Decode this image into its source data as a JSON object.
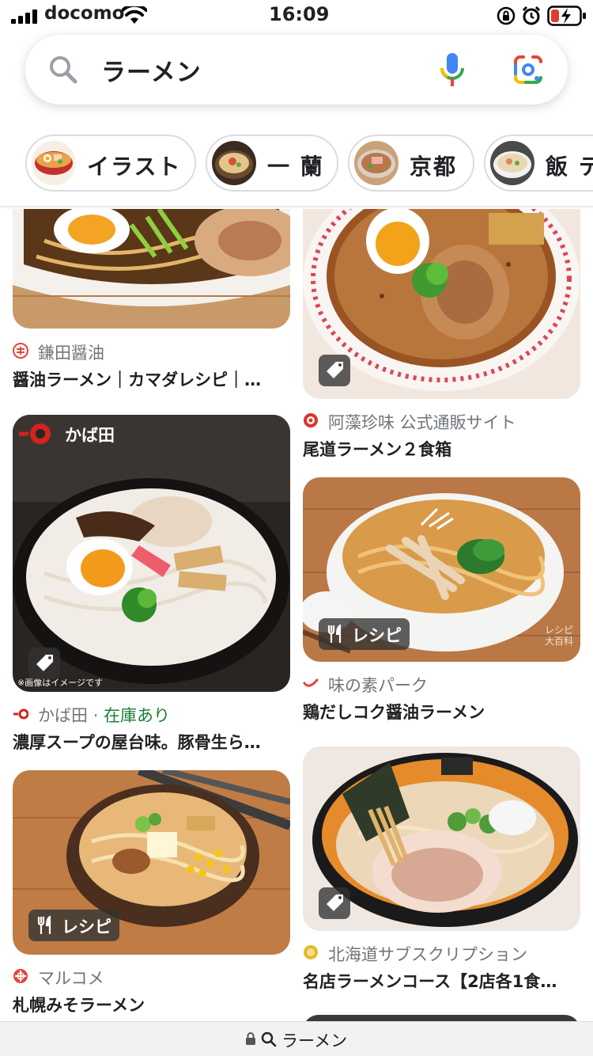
{
  "status_bar": {
    "carrier": "docomo",
    "time": "16:09",
    "icons": [
      "signal-icon",
      "wifi-icon",
      "orientation-lock-icon",
      "alarm-icon",
      "battery-charging-icon"
    ]
  },
  "search": {
    "query": "ラーメン",
    "icons": [
      "search-icon",
      "microphone-icon",
      "google-lens-icon"
    ]
  },
  "chips": [
    {
      "label": "イラスト"
    },
    {
      "label": "一 蘭"
    },
    {
      "label": "京都"
    },
    {
      "label": "飯 テ"
    }
  ],
  "results": [
    {
      "source": "鎌田醤油",
      "title": "醤油ラーメン｜カマダレシピ｜…",
      "badge": null
    },
    {
      "source": "阿藻珍味 公式通販サイト",
      "title": "尾道ラーメン２食箱",
      "badge": "tag-icon"
    },
    {
      "source": "かば田",
      "stock": "在庫あり",
      "separator": "·",
      "title": "濃厚スープの屋台味。豚骨生ら…",
      "badge": "tag-icon",
      "image_text": {
        "brand": "かば田",
        "caption": "※画像はイメージです"
      }
    },
    {
      "source": "味の素パーク",
      "title": "鶏だしコク醤油ラーメン",
      "badge_label": "レシピ",
      "image_text": {
        "watermark": "レシピ大百科"
      }
    },
    {
      "source": "マルコメ",
      "title": "札幌みそラーメン",
      "badge_label": "レシピ"
    },
    {
      "source": "北海道サブスクリプション",
      "title": "名店ラーメンコース【2店各1食…",
      "badge": "tag-icon"
    }
  ],
  "bottom_bar": {
    "url": "ラーメン"
  },
  "colors": {
    "accent_blue": "#4285F4",
    "red": "#EA4335",
    "yellow": "#FBBC04",
    "green": "#34A853",
    "stock_green": "#188038"
  }
}
